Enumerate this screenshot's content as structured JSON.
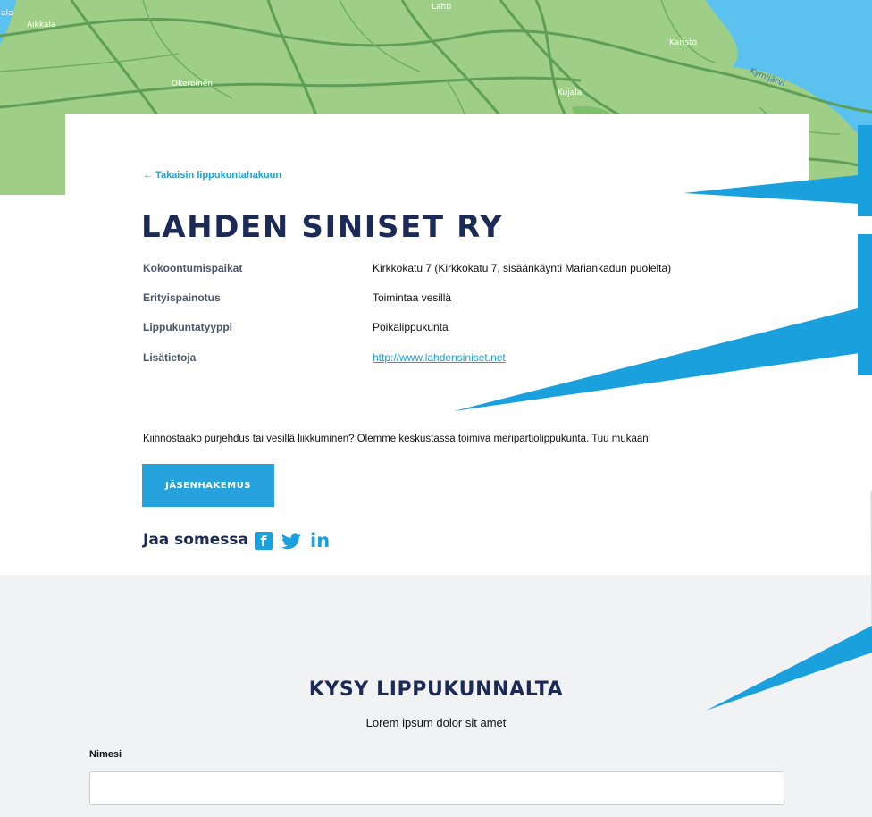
{
  "map": {
    "labels": {
      "lahti": "Lahti",
      "aikkala": "Aikkala",
      "okeroinen": "Okeroinen",
      "karisto": "Karisto",
      "kujala": "Kujala",
      "kymijarvi": "Kymijärvi",
      "edge": "ala"
    }
  },
  "back_link": "← Takaisin lippukuntahakuun",
  "title": "LAHDEN SINISET RY",
  "info": [
    {
      "key": "Kokoontumispaikat",
      "value": "Kirkkokatu 7 (Kirkkokatu 7, sisäänkäynti Mariankadun puolelta)"
    },
    {
      "key": "Erityispainotus",
      "value": "Toimintaa vesillä"
    },
    {
      "key": "Lippukuntatyyppi",
      "value": "Poikalippukunta"
    },
    {
      "key": "Lisätietoja",
      "value": "http://www.lahdensiniset.net"
    }
  ],
  "description": "Kiinnostaako purjehdus tai vesillä liikkuminen? Olemme keskustassa toimiva meripartiolippukunta. Tuu mukaan!",
  "button": "JÄSENHAKEMUS",
  "share": {
    "label": "Jaa somessa",
    "icons": [
      "facebook-icon",
      "twitter-icon",
      "linkedin-icon"
    ],
    "fb_glyph": "f",
    "in_glyph": "in"
  },
  "contact": {
    "title": "KYSY LIPPUKUNNALTA",
    "subtitle": "Lorem ipsum dolor sit amet",
    "name_label": "Nimesi",
    "name_value": ""
  },
  "colors": {
    "accent": "#1aa0dc",
    "button": "#26a2dc",
    "heading": "#1b2a56",
    "map_green": "#9fcf86",
    "map_water": "#5bc2f0",
    "contact_bg": "#f1f2f4",
    "callout": "#1aa0dc"
  }
}
